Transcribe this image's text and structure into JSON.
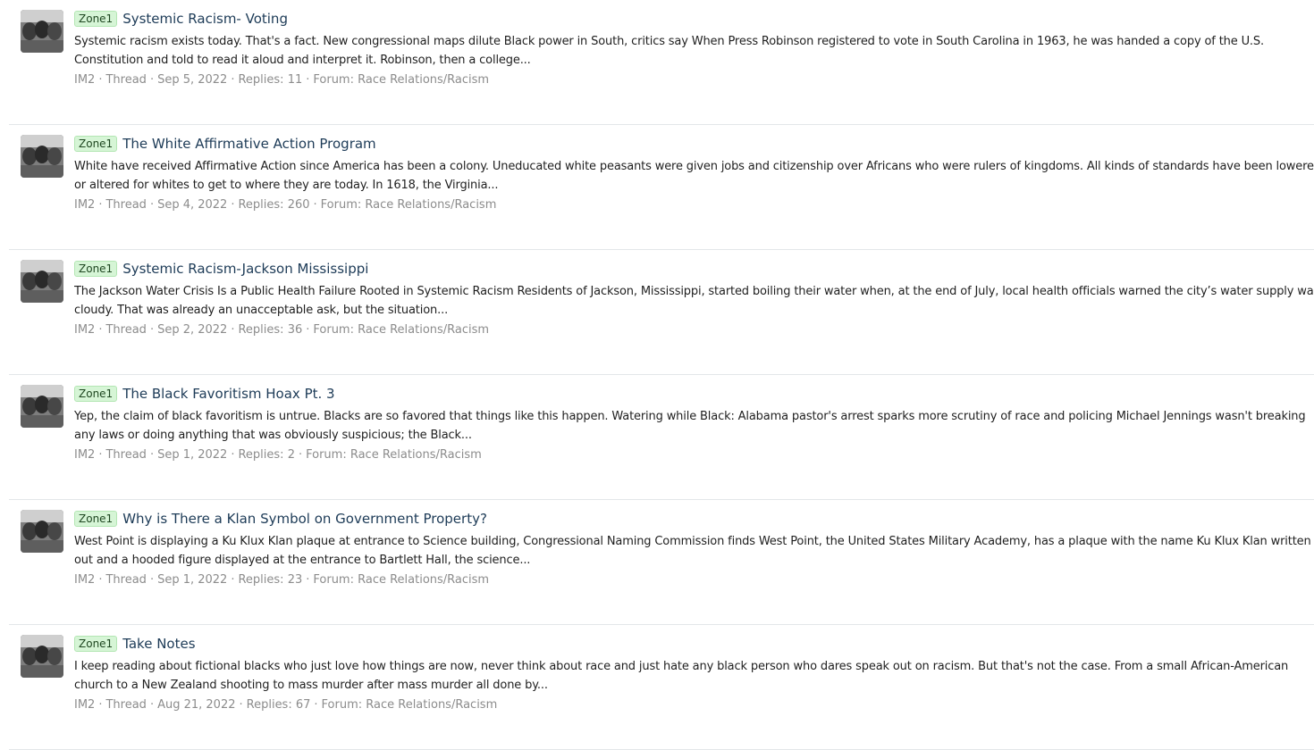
{
  "results": [
    {
      "label": "Zone1",
      "title": "Systemic Racism- Voting",
      "snippet": "Systemic racism exists today. That's a fact. New congressional maps dilute Black power in South, critics say When Press Robinson registered to vote in South Carolina in 1963, he was handed a copy of the U.S. Constitution and told to read it aloud and interpret it. Robinson, then a college...",
      "author": "IM2",
      "type": "Thread",
      "date": "Sep 5, 2022",
      "replies": "Replies: 11",
      "forum": "Forum: Race Relations/Racism"
    },
    {
      "label": "Zone1",
      "title": "The White Affirmative Action Program",
      "snippet": "White have received Affirmative Action since America has been a colony. Uneducated white peasants were given jobs and citizenship over Africans who were rulers of kingdoms. All kinds of standards have been lowered or altered for whites to get to where they are today. In 1618, the Virginia...",
      "author": "IM2",
      "type": "Thread",
      "date": "Sep 4, 2022",
      "replies": "Replies: 260",
      "forum": "Forum: Race Relations/Racism"
    },
    {
      "label": "Zone1",
      "title": "Systemic Racism-Jackson Mississippi",
      "snippet": "The Jackson Water Crisis Is a Public Health Failure Rooted in Systemic Racism Residents of Jackson, Mississippi, started boiling their water when, at the end of July, local health officials warned the city’s water supply was cloudy. That was already an unacceptable ask, but the situation...",
      "author": "IM2",
      "type": "Thread",
      "date": "Sep 2, 2022",
      "replies": "Replies: 36",
      "forum": "Forum: Race Relations/Racism"
    },
    {
      "label": "Zone1",
      "title": "The Black Favoritism Hoax Pt. 3",
      "snippet": "Yep, the claim of black favoritism is untrue. Blacks are so favored that things like this happen. Watering while Black: Alabama pastor's arrest sparks more scrutiny of race and policing Michael Jennings wasn't breaking any laws or doing anything that was obviously suspicious; the Black...",
      "author": "IM2",
      "type": "Thread",
      "date": "Sep 1, 2022",
      "replies": "Replies: 2",
      "forum": "Forum: Race Relations/Racism"
    },
    {
      "label": "Zone1",
      "title": "Why is There a Klan Symbol on Government Property?",
      "snippet": "West Point is displaying a Ku Klux Klan plaque at entrance to Science building, Congressional Naming Commission finds West Point, the United States Military Academy, has a plaque with the name Ku Klux Klan written out and a hooded figure displayed at the entrance to Bartlett Hall, the science...",
      "author": "IM2",
      "type": "Thread",
      "date": "Sep 1, 2022",
      "replies": "Replies: 23",
      "forum": "Forum: Race Relations/Racism"
    },
    {
      "label": "Zone1",
      "title": "Take Notes",
      "snippet": "I keep reading about fictional blacks who just love how things are now, never think about race and just hate any black person who dares speak out on racism. But that's not the case. From a small African-American church to a New Zealand shooting to mass murder after mass murder all done by...",
      "author": "IM2",
      "type": "Thread",
      "date": "Aug 21, 2022",
      "replies": "Replies: 67",
      "forum": "Forum: Race Relations/Racism"
    }
  ],
  "separator": "·"
}
